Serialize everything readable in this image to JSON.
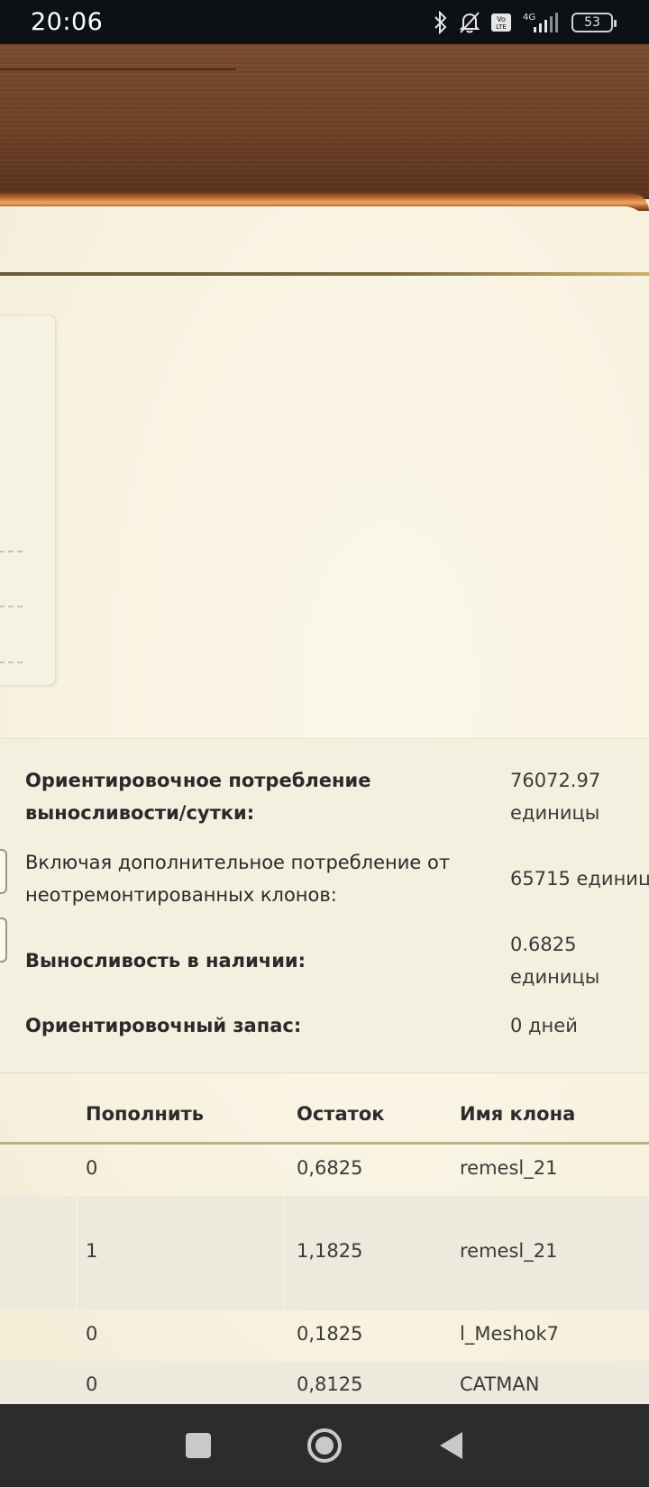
{
  "status_bar": {
    "time": "20:06",
    "battery": "53",
    "network": "4G",
    "icons": [
      "bluetooth-icon",
      "mute-bell-icon",
      "volte-icon",
      "signal-icon",
      "battery-icon"
    ]
  },
  "summary": {
    "rows": [
      {
        "label": "Ориентировочное потребление выносливости/сутки:",
        "value": "76072.97 единицы",
        "bold": true
      },
      {
        "label": "Включая дополнительное потребление от неотремонтированных клонов:",
        "value": "65715 единиц",
        "bold": false
      },
      {
        "label": "Выносливость в наличии:",
        "value": "0.6825 единицы",
        "bold": true
      },
      {
        "label": "Ориентировочный запас:",
        "value": "0 дней",
        "bold": true
      }
    ]
  },
  "table": {
    "headers": {
      "replenish": "Пополнить",
      "remainder": "Остаток",
      "clone_name": "Имя клона"
    },
    "rows": [
      {
        "replenish": "0",
        "remainder": "0,6825",
        "clone_name": "remesl_21"
      },
      {
        "replenish": "1",
        "remainder": "1,1825",
        "clone_name": "remesl_21"
      },
      {
        "replenish": "0",
        "remainder": "0,1825",
        "clone_name": "l_Meshok7"
      },
      {
        "replenish": "0",
        "remainder": "0,8125",
        "clone_name": "CATMAN"
      }
    ]
  },
  "nav": {
    "buttons": [
      "recents-button",
      "home-button",
      "back-button"
    ]
  },
  "colors": {
    "wood": "#6d4026",
    "paper": "#f8f2e0",
    "accent_gold": "#b9b08a",
    "nav": "#2c2c2c"
  }
}
